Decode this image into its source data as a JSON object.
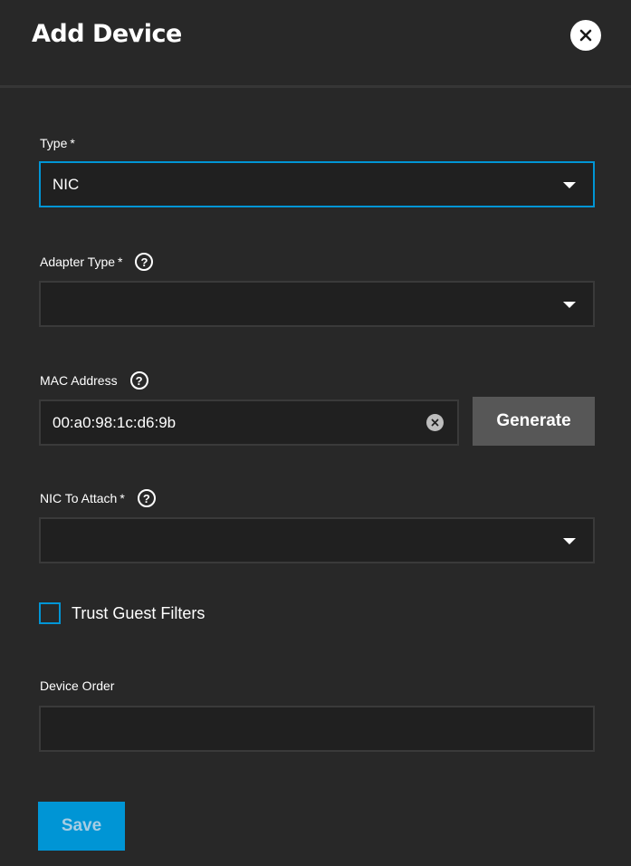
{
  "dialog": {
    "title": "Add Device",
    "close_icon": "close-icon"
  },
  "form": {
    "type": {
      "label": "Type",
      "required_marker": "*",
      "value": "NIC"
    },
    "adapter_type": {
      "label": "Adapter Type",
      "required_marker": "*",
      "help_glyph": "?",
      "value": ""
    },
    "mac_address": {
      "label": "MAC Address",
      "help_glyph": "?",
      "value": "00:a0:98:1c:d6:9b",
      "generate_label": "Generate"
    },
    "nic_to_attach": {
      "label": "NIC To Attach",
      "required_marker": "*",
      "help_glyph": "?",
      "value": ""
    },
    "trust_guest_filters": {
      "label": "Trust Guest Filters",
      "checked": false
    },
    "device_order": {
      "label": "Device Order",
      "value": ""
    },
    "save_label": "Save"
  },
  "colors": {
    "background": "#282828",
    "field_background": "#202020",
    "accent": "#0095d5",
    "secondary_button": "#575757"
  }
}
